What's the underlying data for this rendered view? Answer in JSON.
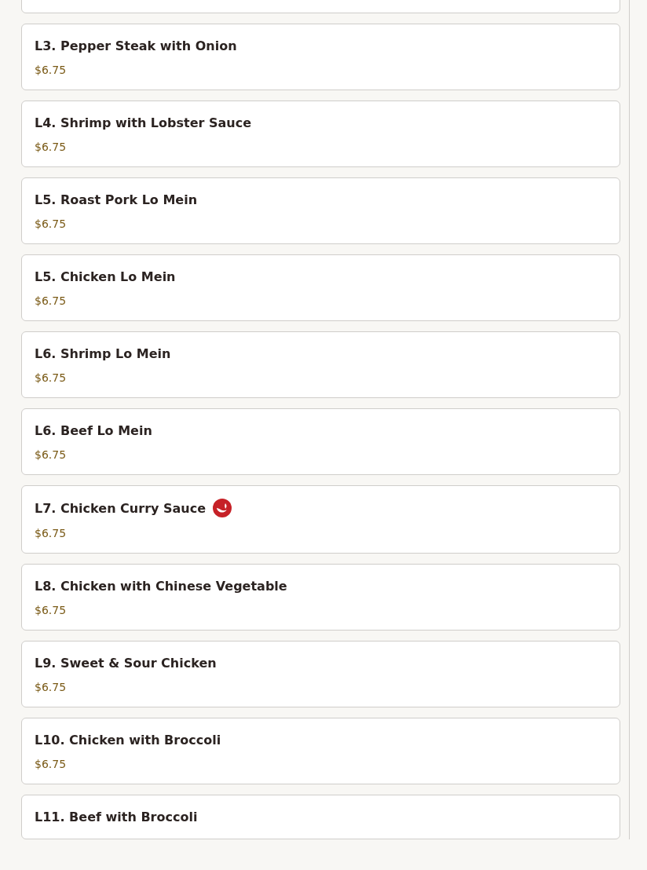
{
  "menu_items": [
    {
      "name": "L3. Pepper Steak with Onion",
      "price": "$6.75",
      "spicy": false
    },
    {
      "name": "L4. Shrimp with Lobster Sauce",
      "price": "$6.75",
      "spicy": false
    },
    {
      "name": "L5. Roast Pork Lo Mein",
      "price": "$6.75",
      "spicy": false
    },
    {
      "name": "L5. Chicken Lo Mein",
      "price": "$6.75",
      "spicy": false
    },
    {
      "name": "L6. Shrimp Lo Mein",
      "price": "$6.75",
      "spicy": false
    },
    {
      "name": "L6. Beef Lo Mein",
      "price": "$6.75",
      "spicy": false
    },
    {
      "name": "L7. Chicken Curry Sauce",
      "price": "$6.75",
      "spicy": true
    },
    {
      "name": "L8. Chicken with Chinese Vegetable",
      "price": "$6.75",
      "spicy": false
    },
    {
      "name": "L9. Sweet & Sour Chicken",
      "price": "$6.75",
      "spicy": false
    },
    {
      "name": "L10. Chicken with Broccoli",
      "price": "$6.75",
      "spicy": false
    },
    {
      "name": "L11. Beef with Broccoli",
      "spicy": false
    }
  ]
}
